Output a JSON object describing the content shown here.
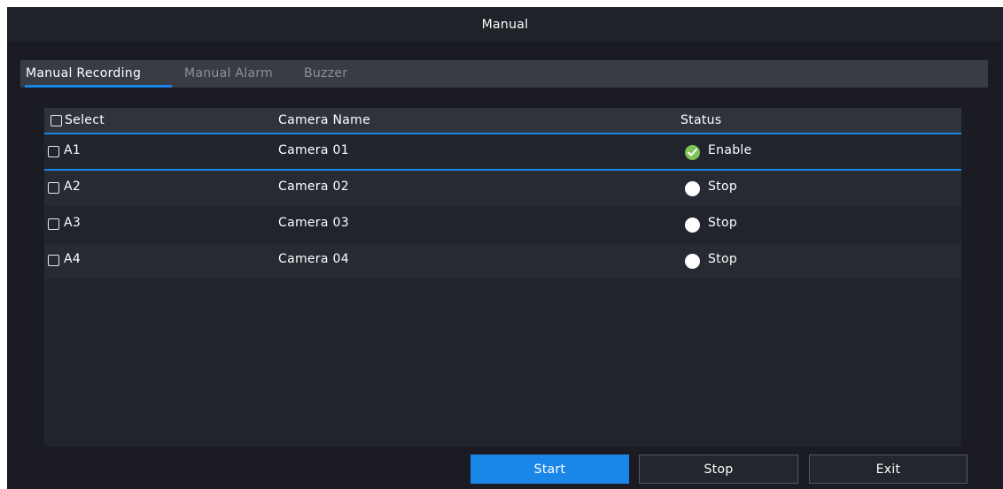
{
  "window": {
    "title": "Manual"
  },
  "tabs": [
    {
      "label": "Manual Recording",
      "active": true
    },
    {
      "label": "Manual Alarm",
      "active": false
    },
    {
      "label": "Buzzer",
      "active": false
    }
  ],
  "table": {
    "columns": {
      "select": "Select",
      "camera_name": "Camera Name",
      "status": "Status"
    },
    "rows": [
      {
        "id": "A1",
        "camera_name": "Camera 01",
        "status": "Enable",
        "checked": false
      },
      {
        "id": "A2",
        "camera_name": "Camera 02",
        "status": "Stop",
        "checked": false
      },
      {
        "id": "A3",
        "camera_name": "Camera 03",
        "status": "Stop",
        "checked": false
      },
      {
        "id": "A4",
        "camera_name": "Camera 04",
        "status": "Stop",
        "checked": false
      }
    ]
  },
  "buttons": {
    "start": "Start",
    "stop": "Stop",
    "exit": "Exit"
  },
  "colors": {
    "accent": "#1a86e8",
    "status_enabled": "#7dc354",
    "status_stopped": "#ffffff",
    "background": "#1b1c23"
  },
  "icons": {
    "status_enabled": "check-circle-icon",
    "status_stopped": "dot-icon"
  }
}
